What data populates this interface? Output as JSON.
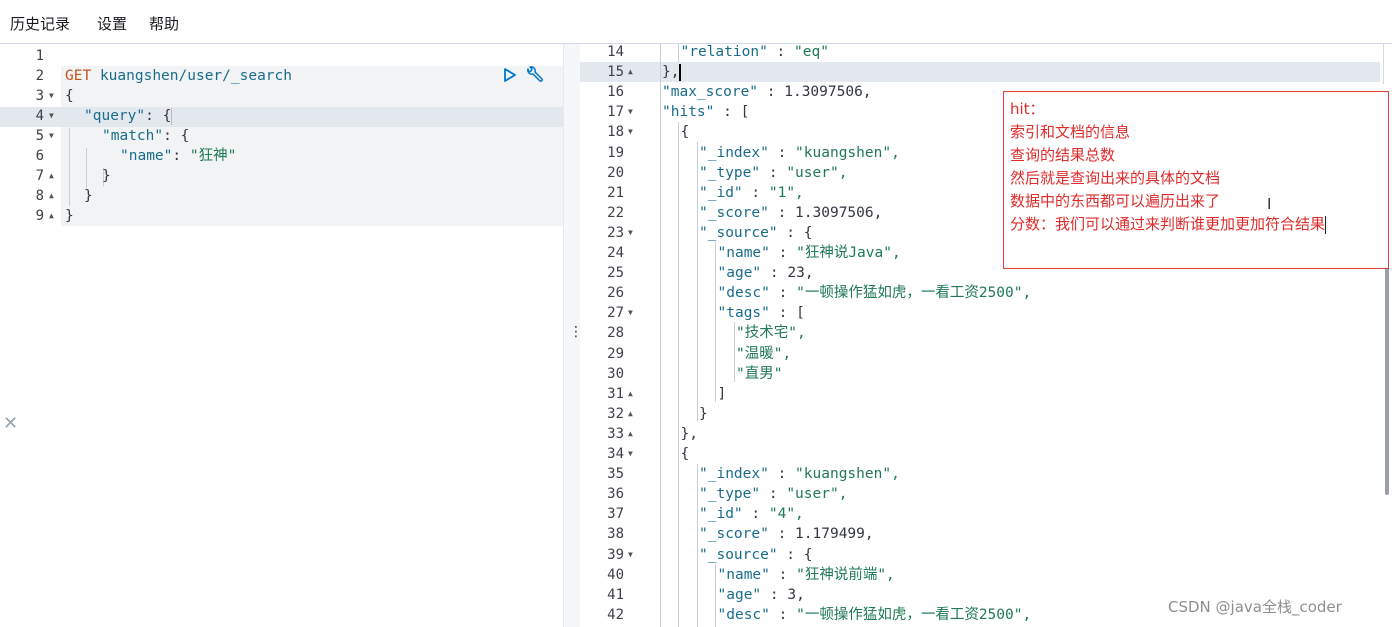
{
  "menu": {
    "items": [
      "历史记录",
      "设置",
      "帮助"
    ]
  },
  "left_editor": {
    "line_numbers": [
      "1",
      "2",
      "3",
      "4",
      "5",
      "6",
      "7",
      "8",
      "9"
    ],
    "line2_method": "GET",
    "line2_url": "kuangshen/user/_search",
    "line3": "{",
    "line4_key": "\"query\"",
    "line4_rest": ": {",
    "line5_key": "\"match\"",
    "line5_rest": ": {",
    "line6_key": "\"name\"",
    "line6_colon": ": ",
    "line6_val": "\"狂神\"",
    "line7": "}",
    "line8": "}",
    "line9": "}"
  },
  "right_output": {
    "line_numbers": [
      "14",
      "15",
      "16",
      "17",
      "18",
      "19",
      "20",
      "21",
      "22",
      "23",
      "24",
      "25",
      "26",
      "27",
      "28",
      "29",
      "30",
      "31",
      "32",
      "33",
      "34",
      "35",
      "36",
      "37",
      "38",
      "39",
      "40",
      "41",
      "42"
    ],
    "lines": [
      {
        "k": "\"relation\"",
        "v": "\"eq\""
      },
      {
        "p": "},"
      },
      {
        "k": "\"max_score\"",
        "n": "1.3097506,"
      },
      {
        "k": "\"hits\"",
        "p": "["
      },
      {
        "p": "{"
      },
      {
        "k": "\"_index\"",
        "v": "\"kuangshen\","
      },
      {
        "k": "\"_type\"",
        "v": "\"user\","
      },
      {
        "k": "\"_id\"",
        "v": "\"1\","
      },
      {
        "k": "\"_score\"",
        "n": "1.3097506,"
      },
      {
        "k": "\"_source\"",
        "p": "{"
      },
      {
        "k": "\"name\"",
        "v": "\"狂神说Java\","
      },
      {
        "k": "\"age\"",
        "n": "23,"
      },
      {
        "k": "\"desc\"",
        "v": "\"一顿操作猛如虎，一看工资2500\","
      },
      {
        "k": "\"tags\"",
        "p": "["
      },
      {
        "v": "\"技术宅\","
      },
      {
        "v": "\"温暖\","
      },
      {
        "v": "\"直男\""
      },
      {
        "p": "]"
      },
      {
        "p": "}"
      },
      {
        "p": "},"
      },
      {
        "p": "{"
      },
      {
        "k": "\"_index\"",
        "v": "\"kuangshen\","
      },
      {
        "k": "\"_type\"",
        "v": "\"user\","
      },
      {
        "k": "\"_id\"",
        "v": "\"4\","
      },
      {
        "k": "\"_score\"",
        "n": "1.179499,"
      },
      {
        "k": "\"_source\"",
        "p": "{"
      },
      {
        "k": "\"name\"",
        "v": "\"狂神说前端\","
      },
      {
        "k": "\"age\"",
        "n": "3,"
      },
      {
        "k": "\"desc\"",
        "v": "\"一顿操作猛如虎，一看工资2500\","
      }
    ]
  },
  "annotation": {
    "lines": [
      "hit：",
      "索引和文档的信息",
      "查询的结果总数",
      "然后就是查询出来的具体的文档",
      "数据中的东西都可以遍历出来了",
      "分数：我们可以通过来判断谁更加更加符合结果"
    ]
  },
  "watermark": "CSDN @java全栈_coder",
  "colors": {
    "annotation": "#e02b2b",
    "method": "#c1541d",
    "key": "#1a6c8c",
    "string": "#1f7a53"
  }
}
